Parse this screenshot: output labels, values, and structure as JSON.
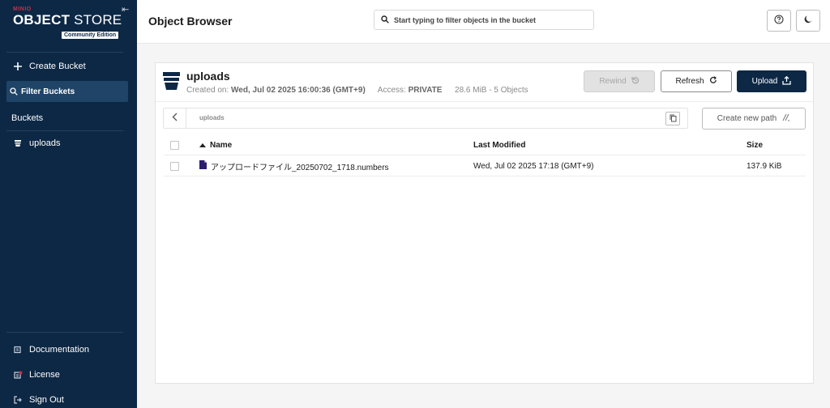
{
  "sidebar": {
    "brand": "MINIO",
    "title_bold": "OBJECT",
    "title_light": " STORE",
    "edition": "Community Edition",
    "create_bucket": "Create Bucket",
    "filter_buckets": "Filter Buckets",
    "section_title": "Buckets",
    "buckets": [
      {
        "label": "uploads"
      }
    ],
    "bottom": [
      {
        "label": "Documentation",
        "icon": "documentation-icon"
      },
      {
        "label": "License",
        "icon": "license-icon"
      },
      {
        "label": "Sign Out",
        "icon": "sign-out-icon"
      }
    ]
  },
  "header": {
    "title": "Object Browser",
    "search_placeholder": "Start typing to filter objects in the bucket"
  },
  "bucket": {
    "name": "uploads",
    "created_label": "Created on:",
    "created_value": "Wed, Jul 02 2025 16:00:36 (GMT+9)",
    "access_label": "Access:",
    "access_value": "PRIVATE",
    "summary": "28.6 MiB - 5 Objects",
    "rewind_label": "Rewind",
    "refresh_label": "Refresh",
    "upload_label": "Upload",
    "path": "uploads",
    "create_path_label": "Create new path"
  },
  "table": {
    "columns": {
      "name": "Name",
      "modified": "Last Modified",
      "size": "Size"
    },
    "rows": [
      {
        "name": "アップロードファイル_20250702_1718.numbers",
        "modified": "Wed, Jul 02 2025 17:18 (GMT+9)",
        "size": "137.9 KiB"
      }
    ]
  },
  "colors": {
    "sidebar": "#0d2845",
    "accent_red": "#c72e49",
    "primary_button": "#0d2845"
  }
}
